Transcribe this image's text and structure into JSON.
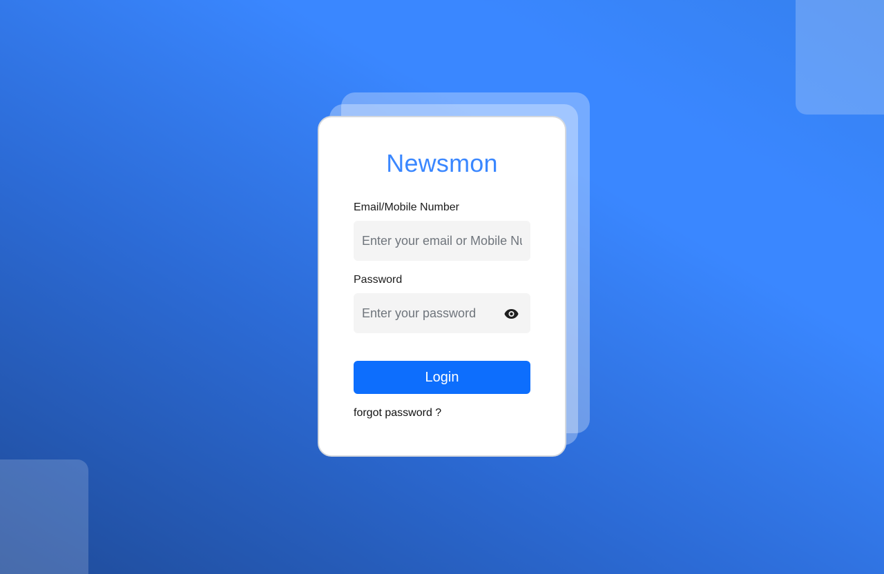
{
  "app": {
    "title": "Newsmon"
  },
  "login_form": {
    "email_label": "Email/Mobile Number",
    "email_placeholder": "Enter your email or Mobile Number",
    "email_value": "",
    "password_label": "Password",
    "password_placeholder": "Enter your password",
    "password_value": "",
    "password_toggle_icon": "eye-icon",
    "login_label": "Login",
    "forgot_label": "forgot password ?"
  },
  "colors": {
    "brand": "#3a87ff",
    "button": "#0d6efd",
    "input_background": "#f4f4f4",
    "background_dark": "#1f4b99",
    "background_light": "#3a87ff"
  }
}
